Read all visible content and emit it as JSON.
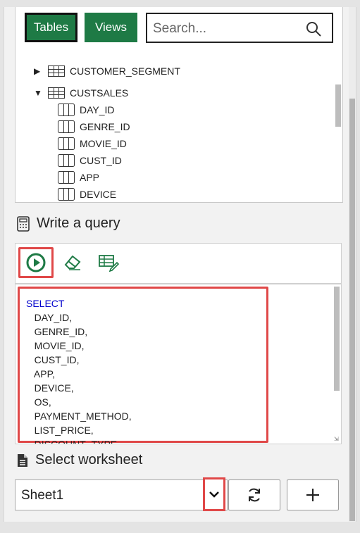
{
  "browser": {
    "tabs": {
      "tables": "Tables",
      "views": "Views"
    },
    "search": {
      "placeholder": "Search..."
    },
    "tree": [
      {
        "label": "CUSTOMER_SEGMENT",
        "expanded": false,
        "type": "table"
      },
      {
        "label": "CUSTSALES",
        "expanded": true,
        "type": "table",
        "columns": [
          "DAY_ID",
          "GENRE_ID",
          "MOVIE_ID",
          "CUST_ID",
          "APP",
          "DEVICE"
        ]
      }
    ]
  },
  "query": {
    "header": "Write a query",
    "icons": [
      "run-icon",
      "eraser-icon",
      "table-edit-icon"
    ],
    "code_keyword": "SELECT",
    "code_lines": [
      "DAY_ID,",
      "GENRE_ID,",
      "MOVIE_ID,",
      "CUST_ID,",
      "APP,",
      "DEVICE,",
      "OS,",
      "PAYMENT_METHOD,",
      "LIST_PRICE,",
      "DISCOUNT_TYPE"
    ]
  },
  "worksheet": {
    "header": "Select worksheet",
    "selected": "Sheet1",
    "buttons": [
      "refresh-icon",
      "add-icon"
    ]
  },
  "colors": {
    "accent": "#1e7a45",
    "highlight": "#e04848",
    "keyword": "#0000cc"
  }
}
